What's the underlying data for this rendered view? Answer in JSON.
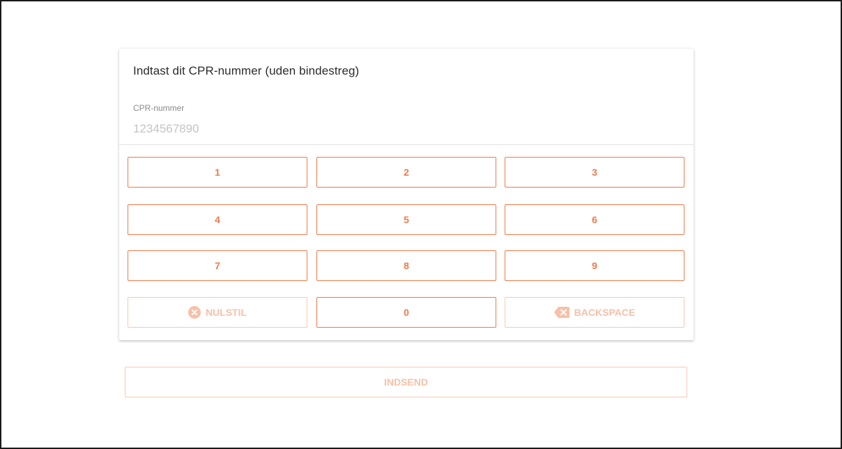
{
  "form": {
    "title": "Indtast dit CPR-nummer (uden bindestreg)",
    "field_label": "CPR-nummer",
    "field_value": "",
    "field_placeholder": "1234567890"
  },
  "keypad": {
    "keys": [
      "1",
      "2",
      "3",
      "4",
      "5",
      "6",
      "7",
      "8",
      "9"
    ],
    "zero": "0",
    "reset_label": "NULSTIL",
    "reset_icon": "close-circle-icon",
    "backspace_label": "BACKSPACE",
    "backspace_icon": "backspace-icon"
  },
  "submit": {
    "label": "INDSEND"
  },
  "colors": {
    "accent": "#f0794a",
    "accent_disabled": "#f8c0a8"
  }
}
